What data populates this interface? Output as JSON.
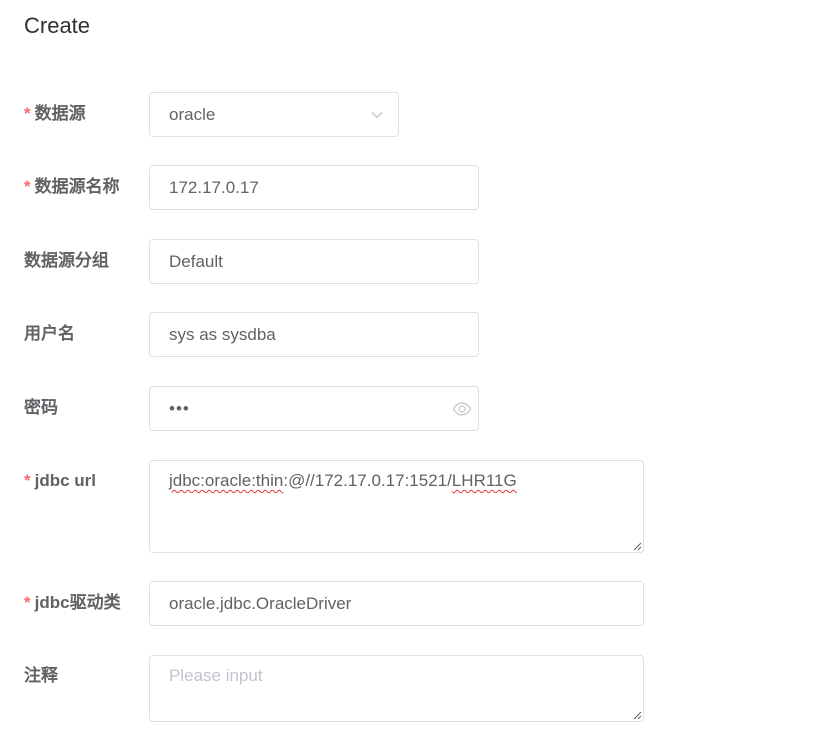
{
  "page": {
    "title": "Create"
  },
  "form": {
    "datasource": {
      "label": "数据源",
      "required": "*",
      "value": "oracle"
    },
    "datasource_name": {
      "label": "数据源名称",
      "required": "*",
      "value": "172.17.0.17"
    },
    "datasource_group": {
      "label": "数据源分组",
      "value": "Default"
    },
    "username": {
      "label": "用户名",
      "value": "sys as sysdba"
    },
    "password": {
      "label": "密码",
      "masked_value": "•••"
    },
    "jdbc_url": {
      "label": "jdbc url",
      "required": "*",
      "value_part1": "jdbc:oracle:thin",
      "value_part2": ":@//172.17.0.17:1521/",
      "value_part3": "LHR11G"
    },
    "jdbc_driver": {
      "label": "jdbc驱动类",
      "required": "*",
      "value": "oracle.jdbc.OracleDriver"
    },
    "comment": {
      "label": "注释",
      "placeholder": "Please input"
    }
  },
  "icons": {
    "select_arrow": "chevron-down-icon",
    "password_toggle": "eye-icon",
    "resize_handle": "resize-handle-icon"
  },
  "colors": {
    "required_marker": "#f56c6c",
    "border": "#dcdfe6",
    "label": "#606266",
    "placeholder": "#c0c4cc",
    "spellcheck": "#e03c3c"
  }
}
